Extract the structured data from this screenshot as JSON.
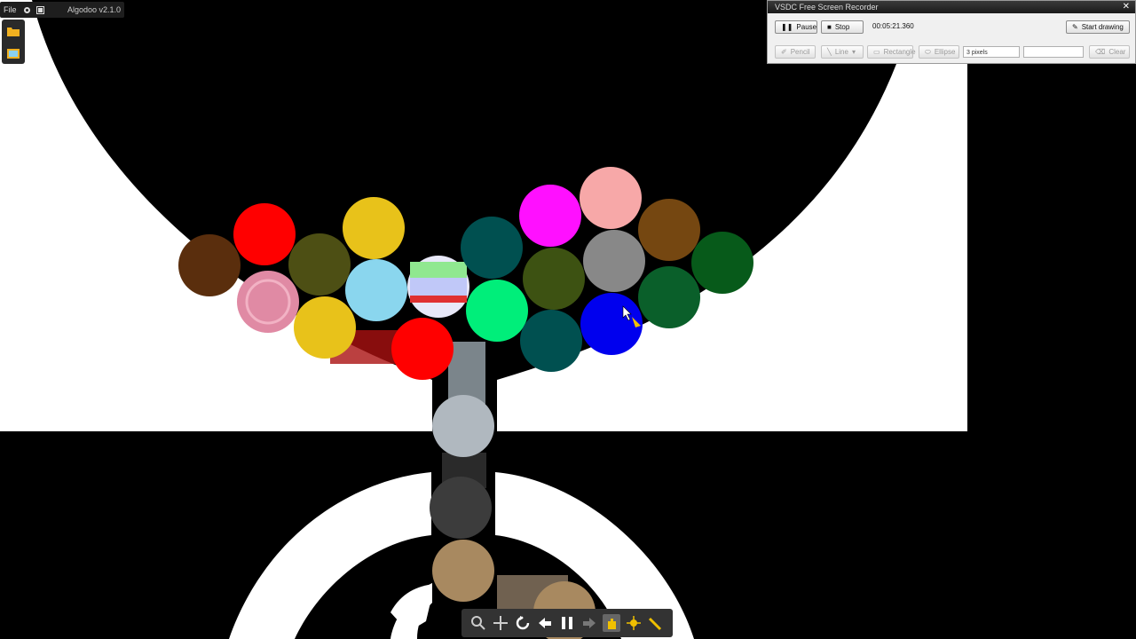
{
  "algodoo": {
    "menu_file": "File",
    "version": "Algodoo v2.1.0"
  },
  "recorder": {
    "title": "VSDC Free Screen Recorder",
    "pause": "Pause",
    "stop": "Stop",
    "time": "00:05:21.360",
    "start_drawing": "Start drawing",
    "pencil": "Pencil",
    "line": "Line",
    "rectangle": "Rectangle",
    "ellipse": "Ellipse",
    "pen_size": "3 pixels",
    "clear": "Clear"
  },
  "colors": {
    "background": "#000000",
    "walls": "#ffffff",
    "balls": [
      "#ff0000",
      "#e8c21a",
      "#5a2e0d",
      "#4d4f14",
      "#8ad6ee",
      "#e08aa4",
      "#ffffff",
      "#005050",
      "#00ee7a",
      "#ff10ff",
      "#f7a8a8",
      "#888888",
      "#754711",
      "#3d5212",
      "#0000ee",
      "#0a5f2a",
      "#075a1a",
      "#b0b8bf",
      "#3c3c3c",
      "#a88960"
    ]
  }
}
